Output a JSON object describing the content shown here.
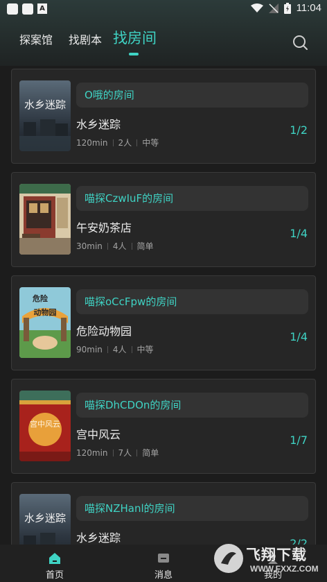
{
  "status": {
    "time": "11:04"
  },
  "tabs": [
    {
      "label": "探案馆",
      "active": false
    },
    {
      "label": "找剧本",
      "active": false
    },
    {
      "label": "找房间",
      "active": true
    }
  ],
  "rooms": [
    {
      "room_name": "O哦的房间",
      "title": "水乡迷踪",
      "duration": "120min",
      "players": "2人",
      "difficulty": "中等",
      "count": "1/2",
      "cover": "water-town-cover"
    },
    {
      "room_name": "喵探CzwIuF的房间",
      "title": "午安奶茶店",
      "duration": "30min",
      "players": "4人",
      "difficulty": "简单",
      "count": "1/4",
      "cover": "milk-tea-shop-cover"
    },
    {
      "room_name": "喵探oCcFpw的房间",
      "title": "危险动物园",
      "duration": "90min",
      "players": "4人",
      "difficulty": "中等",
      "count": "1/4",
      "cover": "zoo-cover"
    },
    {
      "room_name": "喵探DhCDOn的房间",
      "title": "宫中风云",
      "duration": "120min",
      "players": "7人",
      "difficulty": "简单",
      "count": "1/7",
      "cover": "palace-cover"
    },
    {
      "room_name": "喵探NZHanl的房间",
      "title": "水乡迷踪",
      "duration": "",
      "players": "",
      "difficulty": "",
      "count": "2/2",
      "cover": "water-town-cover"
    }
  ],
  "covers": {
    "water_town_text": "水乡迷踪",
    "zoo_text_1": "危险",
    "zoo_text_2": "动物园",
    "palace_text": "宫中风云"
  },
  "bottom_nav": [
    {
      "label": "首页",
      "active": true
    },
    {
      "label": "消息",
      "active": false
    },
    {
      "label": "我的",
      "active": false
    }
  ],
  "watermark": {
    "text": "飞翔下载",
    "sub": "WWW.FXXZ.COM"
  },
  "colors": {
    "accent": "#3fd3c4",
    "background": "#1c1c1c",
    "card": "#262626"
  }
}
